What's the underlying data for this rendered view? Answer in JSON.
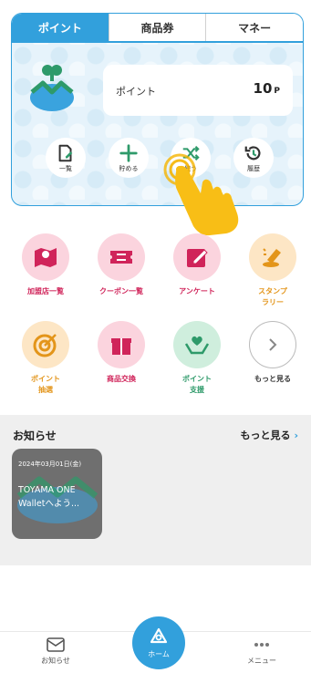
{
  "tabs": [
    {
      "label": "ポイント",
      "active": true
    },
    {
      "label": "商品券",
      "active": false
    },
    {
      "label": "マネー",
      "active": false
    }
  ],
  "points": {
    "label": "ポイント",
    "value": "10",
    "unit": "P"
  },
  "actions": [
    {
      "label": "一覧",
      "icon": "list-icon"
    },
    {
      "label": "貯める",
      "icon": "plus-icon"
    },
    {
      "label": "使う",
      "icon": "shuffle-icon"
    },
    {
      "label": "履歴",
      "icon": "history-icon"
    }
  ],
  "menu": [
    {
      "label": "加盟店一覧",
      "color": "#d0245a",
      "bg": "#fbd4de",
      "icon": "map-icon"
    },
    {
      "label": "クーポン一覧",
      "color": "#d0245a",
      "bg": "#fbd4de",
      "icon": "coupon-icon"
    },
    {
      "label": "アンケート",
      "color": "#d0245a",
      "bg": "#fbd4de",
      "icon": "survey-icon"
    },
    {
      "label": "スタンプ\nラリー",
      "color": "#e3951a",
      "bg": "#fde6c5",
      "icon": "stamp-icon"
    },
    {
      "label": "ポイント\n抽選",
      "color": "#e3951a",
      "bg": "#fde6c5",
      "icon": "target-icon"
    },
    {
      "label": "商品交換",
      "color": "#d0245a",
      "bg": "#fbd4de",
      "icon": "gift-icon"
    },
    {
      "label": "ポイント\n支援",
      "color": "#2e9a6a",
      "bg": "#cfeedd",
      "icon": "heart-hands-icon"
    },
    {
      "label": "もっと見る",
      "color": "#333333",
      "bg": "#ffffff",
      "icon": "chevron-right-icon"
    }
  ],
  "news": {
    "title": "お知らせ",
    "more": "もっと見る",
    "items": [
      {
        "date": "2024年03月01日(金)",
        "text": "TOYAMA ONE Walletへよう..."
      }
    ]
  },
  "nav": {
    "news": "お知らせ",
    "home": "ホーム",
    "menu": "メニュー"
  },
  "colors": {
    "accent": "#32a0dc"
  }
}
